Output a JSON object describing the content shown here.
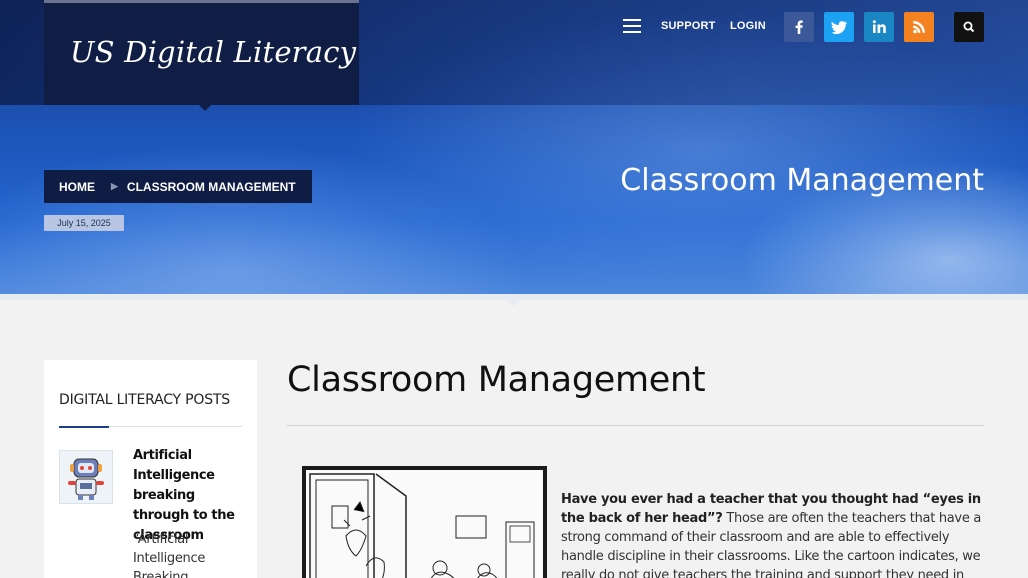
{
  "site": {
    "logo": "US Digital Literacy"
  },
  "nav": {
    "support": "SUPPORT",
    "login": "LOGIN"
  },
  "social": {
    "facebook": "f",
    "twitter": "t",
    "linkedin": "in",
    "rss": "rss"
  },
  "breadcrumb": {
    "home": "HOME",
    "current": "CLASSROOM MANAGEMENT"
  },
  "date": "July 15, 2025",
  "hero": {
    "title": "Classroom Management"
  },
  "sidebar": {
    "heading": "DIGITAL LITERACY POSTS",
    "post": {
      "title": "Artificial Intelligence breaking through to the classroom",
      "excerpt": "“Artificial Intelligence Breaking"
    }
  },
  "main": {
    "title": "Classroom Management",
    "lead_bold": "Have you ever had a teacher that you thought had “eyes in the back of her head”?",
    "lead_text": " Those are often the teachers that have a strong command of their classroom and are able to effectively handle discipline in their classrooms.  Like the cartoon indicates, we really do not give teachers the training and support they need in"
  },
  "colors": {
    "header_dark": "#101e46",
    "hero_blue": "#1d54b8",
    "facebook": "#3b5998",
    "twitter": "#1da1f2",
    "linkedin": "#1b86c4",
    "rss": "#f58220"
  }
}
